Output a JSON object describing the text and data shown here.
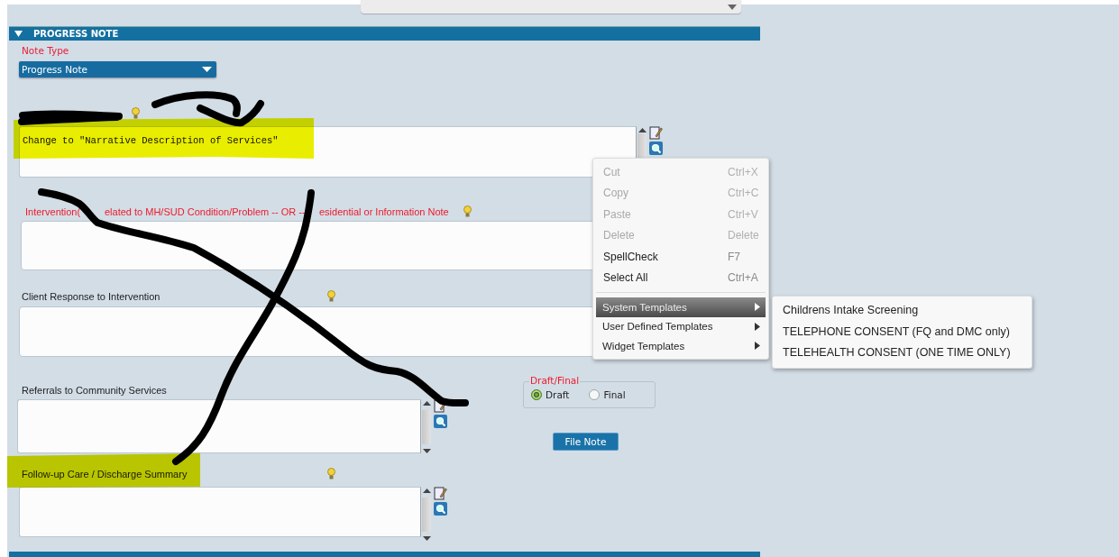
{
  "section": {
    "title": "PROGRESS NOTE",
    "expanded": true
  },
  "note_type": {
    "label": "Note Type",
    "value": "Progress Note"
  },
  "fields": [
    {
      "value": "Change to \"Narrative Description of Services\"",
      "hint": true,
      "tools": true
    },
    {
      "label_parts": [
        "Intervention(",
        "elated to MH/SUD Condition/Problem -- OR --",
        "esidential or Information Note"
      ],
      "required": true,
      "hint": true,
      "tools": false
    },
    {
      "label": "Client Response to Intervention",
      "required": false,
      "hint": true,
      "tools": false
    },
    {
      "label": "Referrals to Community Services",
      "required": false,
      "hint": false,
      "tools": true
    },
    {
      "label": "Follow-up Care / Discharge Summary",
      "required": false,
      "hint": true,
      "tools": true
    }
  ],
  "draft_final": {
    "legend": "Draft/Final",
    "options": [
      {
        "label": "Draft",
        "selected": true
      },
      {
        "label": "Final",
        "selected": false
      }
    ]
  },
  "file_note_button": "File Note",
  "context_menu": {
    "items": [
      {
        "kind": "command",
        "label": "Cut",
        "shortcut": "Ctrl+X",
        "disabled": true,
        "selected": false
      },
      {
        "kind": "command",
        "label": "Copy",
        "shortcut": "Ctrl+C",
        "disabled": true,
        "selected": false
      },
      {
        "kind": "command",
        "label": "Paste",
        "shortcut": "Ctrl+V",
        "disabled": true,
        "selected": false
      },
      {
        "kind": "command",
        "label": "Delete",
        "shortcut": "Delete",
        "disabled": true,
        "selected": false
      },
      {
        "kind": "command",
        "label": "SpellCheck",
        "shortcut": "F7",
        "disabled": false,
        "selected": false
      },
      {
        "kind": "command",
        "label": "Select All",
        "shortcut": "Ctrl+A",
        "disabled": false,
        "selected": false
      },
      {
        "kind": "submenu",
        "label": "System Templates",
        "disabled": false,
        "selected": true
      },
      {
        "kind": "submenu",
        "label": "User Defined Templates",
        "disabled": false,
        "selected": false
      },
      {
        "kind": "submenu",
        "label": "Widget Templates",
        "disabled": false,
        "selected": false
      }
    ]
  },
  "submenu": {
    "items": [
      "Childrens Intake Screening",
      "TELEPHONE CONSENT (FQ and DMC only)",
      "TELEHEALTH CONSENT (ONE TIME ONLY)"
    ]
  }
}
